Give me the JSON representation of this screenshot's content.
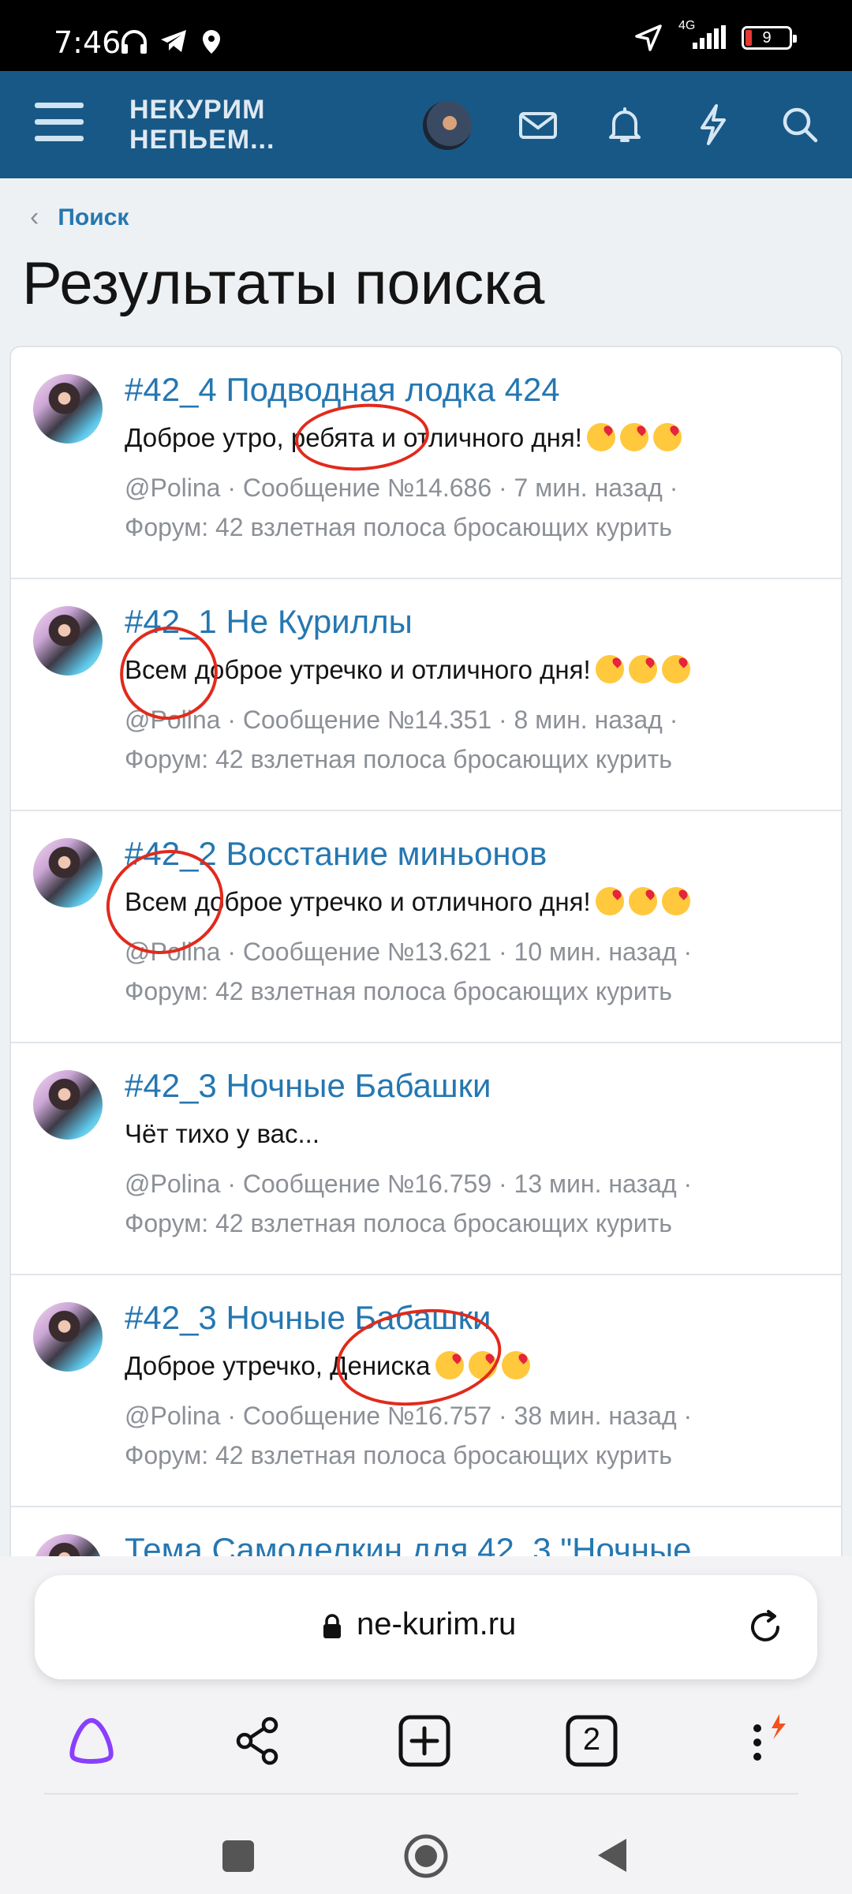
{
  "status_bar": {
    "time": "7:46",
    "network": "4G",
    "battery": "9"
  },
  "header": {
    "logo_line1": "НЕКУРИМ",
    "logo_line2": "НЕПЬЕМ...",
    "icons": [
      "menu-icon",
      "avatar",
      "mail-icon",
      "bell-icon",
      "lightning-icon",
      "search-icon"
    ]
  },
  "breadcrumb": {
    "label": "Поиск"
  },
  "page_title": "Результаты поиска",
  "results": [
    {
      "title": "#42_4 Подводная лодка 424",
      "snippet": "Доброе утро, ребята и отличного дня!",
      "emoji_count": 3,
      "meta1": "@Polina · Сообщение №14.686 · 7 мин. назад ·",
      "meta2": "Форум: 42 взлетная полоса бросающих курить"
    },
    {
      "title": "#42_1 Не Куриллы",
      "snippet": "Всем доброе утречко и отличного дня!",
      "emoji_count": 3,
      "meta1": "@Polina · Сообщение №14.351 · 8 мин. назад ·",
      "meta2": "Форум: 42 взлетная полоса бросающих курить"
    },
    {
      "title": "#42_2 Восстание миньонов",
      "snippet": "Всем доброе утречко и отличного дня!",
      "emoji_count": 3,
      "meta1": "@Polina · Сообщение №13.621 · 10 мин. назад ·",
      "meta2": "Форум: 42 взлетная полоса бросающих курить"
    },
    {
      "title": "#42_3 Ночные Бабашки",
      "snippet": "Чёт тихо у вас...",
      "emoji_count": 0,
      "meta1": "@Polina · Сообщение №16.759 · 13 мин. назад ·",
      "meta2": "Форум: 42 взлетная полоса бросающих курить"
    },
    {
      "title": "#42_3 Ночные Бабашки",
      "snippet": "Доброе утречко, Дениска",
      "emoji_count": 3,
      "meta1": "@Polina · Сообщение №16.757 · 38 мин. назад ·",
      "meta2": "Форум: 42 взлетная полоса бросающих курить"
    },
    {
      "title": "Тема Самоделкин для 42_3 \"Ночные",
      "snippet": "",
      "emoji_count": 0,
      "meta1": "",
      "meta2": ""
    }
  ],
  "browser": {
    "url": "ne-kurim.ru",
    "tab_count": "2",
    "toolbar_icons": [
      "alice-icon",
      "share-icon",
      "new-tab-icon",
      "tabs-icon",
      "more-icon"
    ]
  },
  "colors": {
    "header": "#185886",
    "link": "#2577b1",
    "annotation": "#e12a1c"
  }
}
